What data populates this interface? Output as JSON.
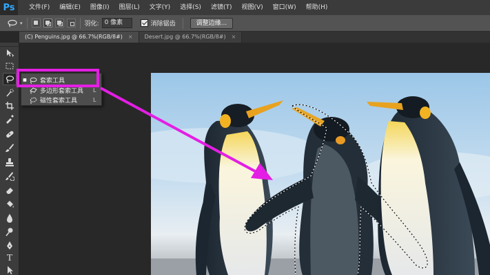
{
  "app": {
    "logo": "Ps"
  },
  "menu": [
    "文件(F)",
    "编辑(E)",
    "图像(I)",
    "图层(L)",
    "文字(Y)",
    "选择(S)",
    "滤镜(T)",
    "视图(V)",
    "窗口(W)",
    "帮助(H)"
  ],
  "options": {
    "tool_preset_icon": "lasso-icon",
    "feather_label": "羽化:",
    "feather_value": "0 像素",
    "antialias_label": "消除锯齿",
    "antialias_checked": true,
    "refine_edge_label": "调整边缘..."
  },
  "tabs": [
    {
      "label": "(C) Penguins.jpg @ 66.7%(RGB/8#)",
      "active": true,
      "close": "×"
    },
    {
      "label": "Desert.jpg @ 66.7%(RGB/8#)",
      "active": false,
      "close": "×"
    }
  ],
  "toolbar": {
    "tools": [
      "move-icon",
      "marquee-icon",
      "lasso-icon",
      "quick-select-icon",
      "crop-icon",
      "eyedropper-icon",
      "healing-brush-icon",
      "brush-icon",
      "clone-stamp-icon",
      "history-brush-icon",
      "eraser-icon",
      "paint-bucket-icon",
      "blur-icon",
      "dodge-icon",
      "pen-icon",
      "type-icon",
      "path-select-icon"
    ],
    "active_tool": "lasso-icon"
  },
  "flyout": {
    "items": [
      {
        "label": "套索工具",
        "key": "",
        "selected": true,
        "icon": "lasso-icon"
      },
      {
        "label": "多边形套索工具",
        "key": "L",
        "selected": false,
        "icon": "polygonal-lasso-icon"
      },
      {
        "label": "磁性套索工具",
        "key": "L",
        "selected": false,
        "icon": "magnetic-lasso-icon"
      }
    ]
  },
  "annotation": {
    "highlight_color": "#e41ee4",
    "arrow_color": "#e41ee4"
  },
  "colors": {
    "menubar": "#3b3b3b",
    "optionsbar": "#535353",
    "workspace": "#282828",
    "accent": "#31a8ff"
  }
}
